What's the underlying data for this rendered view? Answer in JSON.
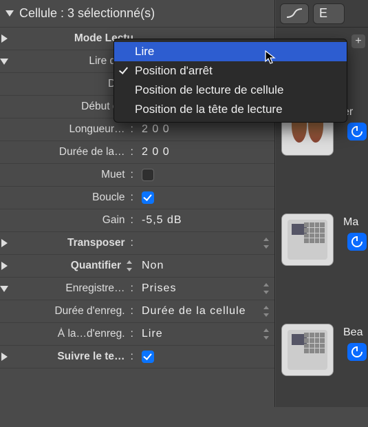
{
  "panel": {
    "title": "Cellule : 3 sélectionné(s)",
    "rows": {
      "mode_lecture": "Mode Lectu",
      "lire_depu": "Lire depu",
      "depa": "Dépa",
      "debut_b": "Début de b",
      "longueur": "Longueur…",
      "duree_la": "Durée de la…",
      "muet": "Muet",
      "boucle": "Boucle",
      "gain": "Gain",
      "transposer": "Transposer",
      "quantifier": "Quantifier",
      "enregistre": "Enregistre…",
      "duree_enreg": "Durée d'enreg.",
      "a_la_enreg": "À la…d'enreg.",
      "suivre_te": "Suivre le te…"
    },
    "values": {
      "longueur": "2  0  0",
      "duree_la": "2  0  0",
      "gain": "-5,5 dB",
      "quantifier": "Non",
      "enregistre": "Prises",
      "duree_enreg": "Durée de la cellule",
      "a_la_enreg": "Lire"
    }
  },
  "popup": {
    "items": [
      "Lire",
      "Position d'arrêt",
      "Position de lecture de cellule",
      "Position de la tête de lecture"
    ],
    "highlighted_index": 0,
    "checked_index": 1
  },
  "right": {
    "button_letter": "E",
    "plus": "+",
    "slots": [
      {
        "label": "er"
      },
      {
        "label": "Ma"
      },
      {
        "label": "Bea"
      }
    ]
  }
}
